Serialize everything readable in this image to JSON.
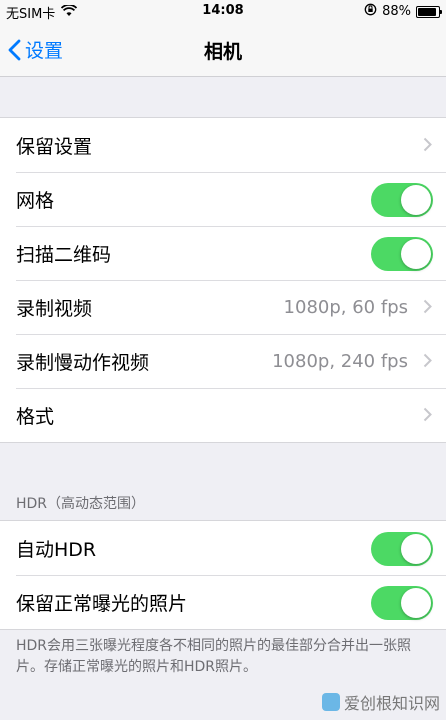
{
  "status_bar": {
    "carrier": "无SIM卡",
    "time": "14:08",
    "battery_percent": "88%",
    "battery_level": 0.88
  },
  "nav": {
    "back_label": "设置",
    "title": "相机"
  },
  "group1": [
    {
      "label": "保留设置",
      "type": "link"
    },
    {
      "label": "网格",
      "type": "toggle",
      "on": true
    },
    {
      "label": "扫描二维码",
      "type": "toggle",
      "on": true
    },
    {
      "label": "录制视频",
      "type": "link",
      "value": "1080p, 60 fps"
    },
    {
      "label": "录制慢动作视频",
      "type": "link",
      "value": "1080p, 240 fps"
    },
    {
      "label": "格式",
      "type": "link"
    }
  ],
  "hdr_section": {
    "header": "HDR（高动态范围）",
    "rows": [
      {
        "label": "自动HDR",
        "type": "toggle",
        "on": true
      },
      {
        "label": "保留正常曝光的照片",
        "type": "toggle",
        "on": true
      }
    ],
    "footer": "HDR会用三张曝光程度各不相同的照片的最佳部分合并出一张照片。存储正常曝光的照片和HDR照片。"
  },
  "watermark": "爱创根知识网",
  "colors": {
    "accent": "#007aff",
    "toggle_on": "#4cd964",
    "background": "#efeff4"
  }
}
